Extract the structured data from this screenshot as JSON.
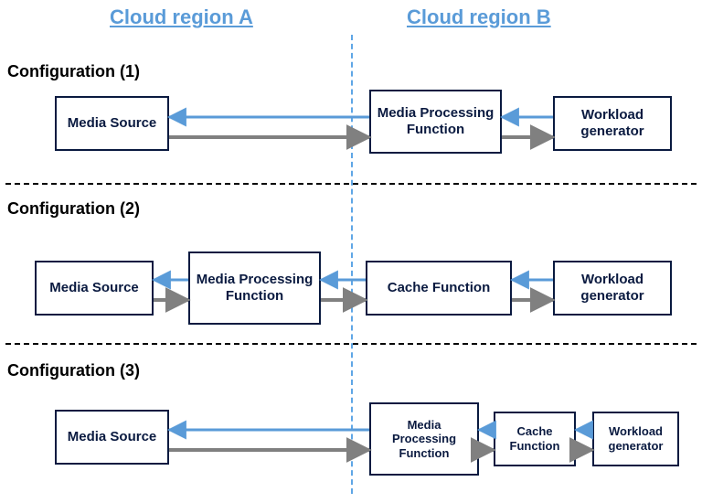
{
  "regions": {
    "a": "Cloud region A",
    "b": "Cloud region B"
  },
  "configs": {
    "c1": {
      "label": "Configuration (1)",
      "boxes": {
        "media_source": "Media Source",
        "media_processing": "Media Processing Function",
        "workload_gen": "Workload generator"
      }
    },
    "c2": {
      "label": "Configuration (2)",
      "boxes": {
        "media_source": "Media Source",
        "media_processing": "Media Processing Function",
        "cache": "Cache Function",
        "workload_gen": "Workload generator"
      }
    },
    "c3": {
      "label": "Configuration (3)",
      "boxes": {
        "media_source": "Media Source",
        "media_processing": "Media Processing Function",
        "cache": "Cache Function",
        "workload_gen": "Workload generator"
      }
    }
  },
  "arrow_colors": {
    "blue": "#5a9bd8",
    "gray": "#808080"
  }
}
